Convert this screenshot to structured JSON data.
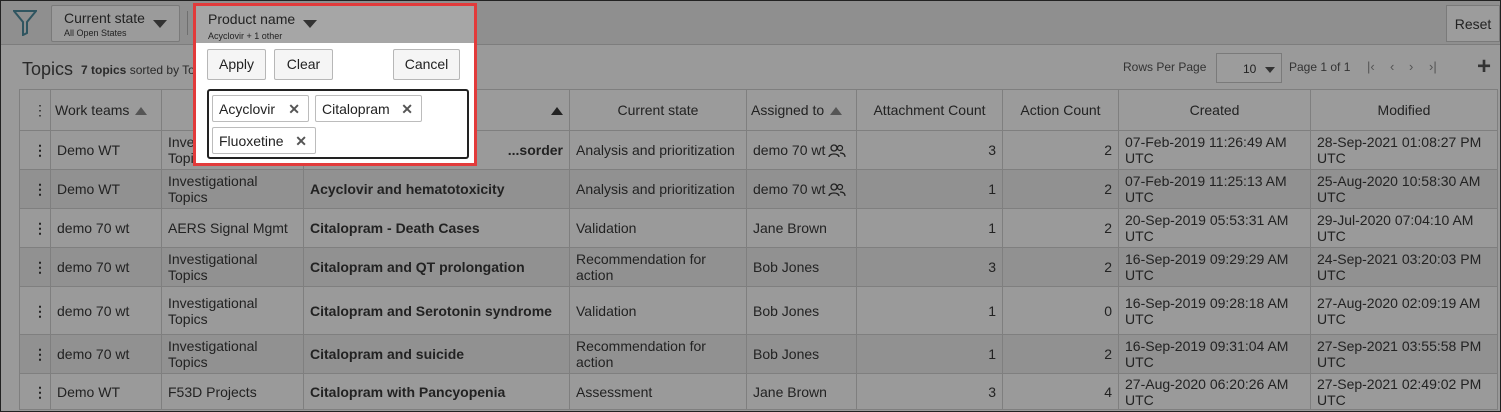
{
  "filters": {
    "state_chip": {
      "title": "Current state",
      "subtitle": "All Open States"
    },
    "product_chip": {
      "title": "Product name",
      "subtitle": "Acyclovir + 1 other"
    },
    "reset_label": "Reset"
  },
  "dropdown": {
    "apply_label": "Apply",
    "clear_label": "Clear",
    "cancel_label": "Cancel",
    "tags": [
      "Acyclovir",
      "Citalopram",
      "Fluoxetine"
    ]
  },
  "topics": {
    "title": "Topics",
    "count": "7 topics",
    "sorted_by": "sorted by To"
  },
  "pager": {
    "rows_per_page_label": "Rows Per Page",
    "rows_per_page_value": "10",
    "page_label": "Page 1 of 1"
  },
  "columns": {
    "work_teams": "Work teams",
    "current_state": "Current state",
    "assigned_to": "Assigned to",
    "attachment_count": "Attachment Count",
    "action_count": "Action Count",
    "created": "Created",
    "modified": "Modified"
  },
  "rows": [
    {
      "team": "Demo WT",
      "type": "Investigational Topics",
      "name": "...sorder",
      "state": "Analysis and prioritization",
      "assigned": "demo 70 wt",
      "attachments": "3",
      "actions": "2",
      "created": "07-Feb-2019 11:26:49 AM UTC",
      "modified": "28-Sep-2021 01:08:27 PM UTC"
    },
    {
      "team": "Demo WT",
      "type": "Investigational Topics",
      "name": "Acyclovir and hematotoxicity",
      "state": "Analysis and prioritization",
      "assigned": "demo 70 wt",
      "attachments": "1",
      "actions": "2",
      "created": "07-Feb-2019 11:25:13 AM UTC",
      "modified": "25-Aug-2020 10:58:30 AM UTC"
    },
    {
      "team": "demo 70 wt",
      "type": "AERS Signal Mgmt",
      "name": "Citalopram - Death Cases",
      "state": "Validation",
      "assigned": "Jane Brown",
      "attachments": "1",
      "actions": "2",
      "created": "20-Sep-2019 05:53:31 AM UTC",
      "modified": "29-Jul-2020 07:04:10 AM UTC"
    },
    {
      "team": "demo 70 wt",
      "type": "Investigational Topics",
      "name": "Citalopram and QT prolongation",
      "state": "Recommendation for action",
      "assigned": "Bob Jones",
      "attachments": "3",
      "actions": "2",
      "created": "16-Sep-2019 09:29:29 AM UTC",
      "modified": "24-Sep-2021 03:20:03 PM UTC"
    },
    {
      "team": "demo 70 wt",
      "type": "Investigational Topics",
      "name": "Citalopram and Serotonin syndrome",
      "state": "Validation",
      "assigned": "Bob Jones",
      "attachments": "1",
      "actions": "0",
      "created": "16-Sep-2019 09:28:18 AM UTC",
      "modified": "27-Aug-2020 02:09:19 AM UTC"
    },
    {
      "team": "demo 70 wt",
      "type": "Investigational Topics",
      "name": "Citalopram and suicide",
      "state": "Recommendation for action",
      "assigned": "Bob Jones",
      "attachments": "1",
      "actions": "2",
      "created": "16-Sep-2019 09:31:04 AM UTC",
      "modified": "27-Sep-2021 03:55:58 PM UTC"
    },
    {
      "team": "Demo WT",
      "type": "F53D Projects",
      "name": "Citalopram with Pancyopenia",
      "state": "Assessment",
      "assigned": "Jane Brown",
      "attachments": "3",
      "actions": "4",
      "created": "27-Aug-2020 06:20:26 AM UTC",
      "modified": "27-Sep-2021 02:49:02 PM UTC"
    }
  ]
}
